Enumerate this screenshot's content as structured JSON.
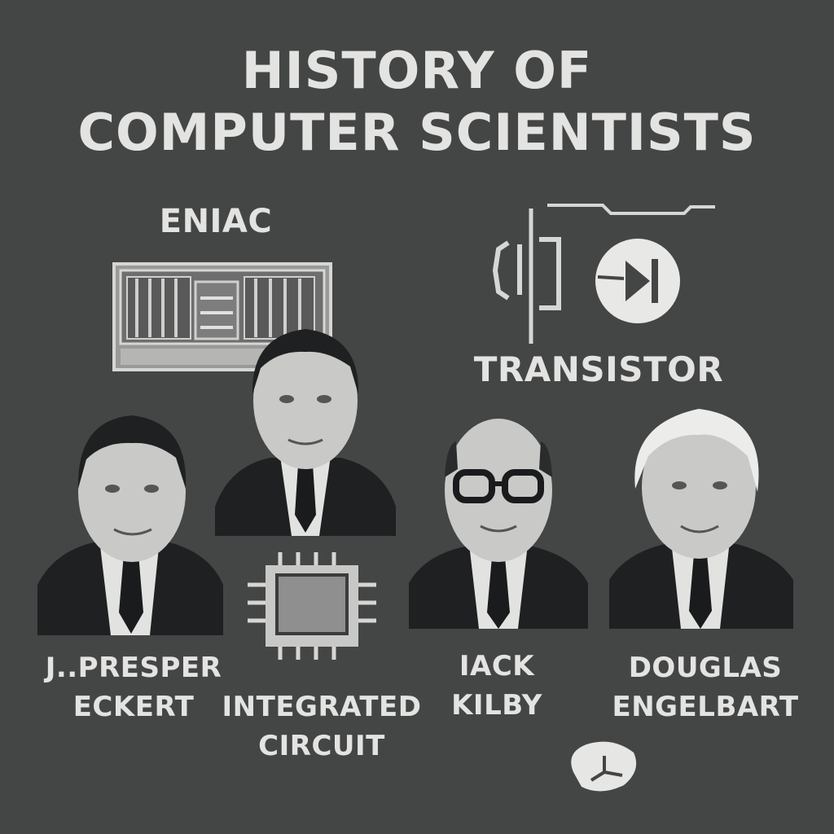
{
  "title": {
    "line1": "HISTORY OF",
    "line2": "COMPUTER SCIENTISTS"
  },
  "labels": {
    "eniac": "ENIAC",
    "transistor": "TRANSISTOR",
    "integrated_circuit_line1": "INTEGRATED",
    "integrated_circuit_line2": "CIRCUIT",
    "eckert_line1": "J..PRESPER",
    "eckert_line2": "ECKERT",
    "kilby_line1": "IACK",
    "kilby_line2": "KILBY",
    "engelbart_line1": "DOUGLAS",
    "engelbart_line2": "ENGELBART"
  },
  "colors": {
    "background": "#444646",
    "text": "#e3e3e1",
    "suit": "#1f2021",
    "skin": "#c9c9c7",
    "line": "#d6d6d4"
  }
}
